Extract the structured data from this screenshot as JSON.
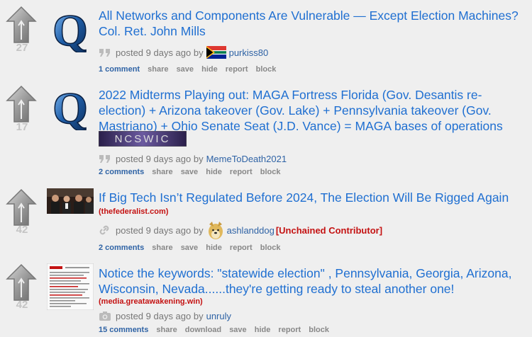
{
  "posts": [
    {
      "score": "27",
      "title": "All Networks and Components Are Vulnerable — Except Election Machines? Col. Ret. John Mills",
      "domain": "",
      "thumb": "q-logo",
      "posted": "posted 9 days ago by",
      "author": "purkiss80",
      "flag": "south-africa-flag",
      "author_tag": "",
      "comments": "1 comment",
      "actions": [
        "share",
        "save",
        "hide",
        "report",
        "block"
      ]
    },
    {
      "score": "17",
      "title": "2022 Midterms Playing out: MAGA Fortress Florida (Gov. Desantis re-election) + Arizona takeover (Gov. Lake) + Pennsylvania takeover (Gov. Mastriano) + Ohio Senate Seat (J.D. Vance) = MAGA bases of operations nationwide",
      "banner_text": "NCSWIC",
      "domain": "",
      "thumb": "q-logo",
      "posted": "posted 9 days ago by",
      "author": "MemeToDeath2021",
      "author_tag": "",
      "comments": "2 comments",
      "actions": [
        "share",
        "save",
        "hide",
        "report",
        "block"
      ]
    },
    {
      "score": "42",
      "title": "If Big Tech Isn’t Regulated Before 2024, The Election Will Be Rigged Again",
      "domain": "(thefederalist.com)",
      "thumb": "hearing-photo",
      "posted": "posted 9 days ago by",
      "author": "ashlanddog",
      "avatar": "doge-avatar",
      "author_tag": "[Unchained Contributor]",
      "comments": "2 comments",
      "actions": [
        "share",
        "save",
        "hide",
        "report",
        "block"
      ]
    },
    {
      "score": "42",
      "title": "Notice the keywords: \"statewide election\" , Pennsylvania, Georgia, Arizona, Wisconsin, Nevada......they're getting ready to steal another one!",
      "domain": "(media.greatawakening.win)",
      "thumb": "document-screenshot",
      "posted": "posted 9 days ago by",
      "author": "unruly",
      "author_tag": "",
      "comments": "15 comments",
      "actions": [
        "share",
        "download",
        "save",
        "hide",
        "report",
        "block"
      ]
    }
  ],
  "colors": {
    "title": "#1f6fd1",
    "author": "#2f63a5",
    "tag": "#c41212",
    "score": "#c4c4c4"
  }
}
